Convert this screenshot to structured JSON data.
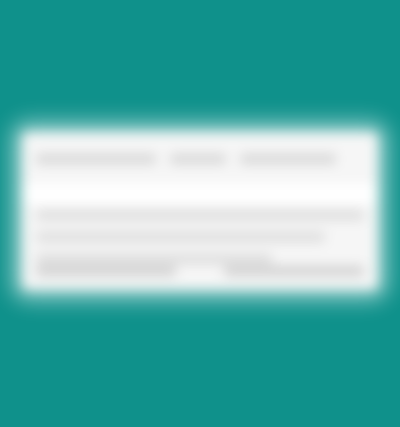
{
  "colors": {
    "desktop_background": "#0f918b",
    "card_background": "#f6f6f6",
    "placeholder_text": "#d6d6d6"
  },
  "card": {
    "top": {
      "left": "",
      "middle": "",
      "right": ""
    },
    "rows": [
      {
        "text": ""
      },
      {
        "text": ""
      },
      {
        "text": ""
      }
    ],
    "bottom": {
      "left": "",
      "right": ""
    }
  }
}
